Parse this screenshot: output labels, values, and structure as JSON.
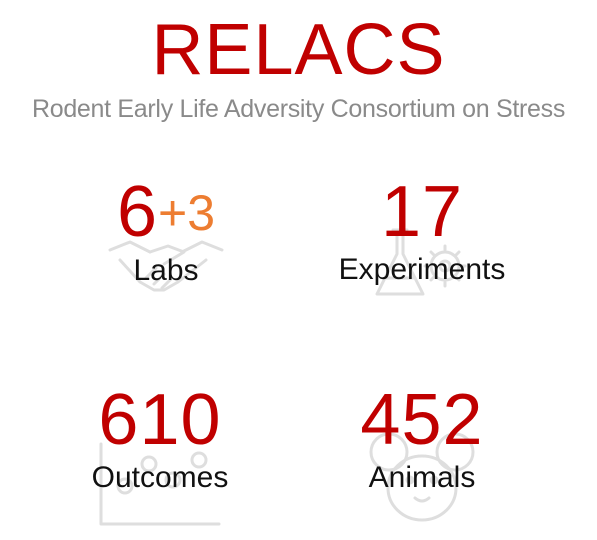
{
  "title": "RELACS",
  "subtitle": "Rodent Early Life Adversity Consortium on Stress",
  "colors": {
    "accent": "#C00000",
    "highlight": "#ED7D31",
    "subtitle": "#8a8a8a",
    "label": "#111111",
    "icon": "#d9d9d9"
  },
  "stats": {
    "labs": {
      "value": "6",
      "extra": "+3",
      "label": "Labs",
      "icon": "handshake-icon"
    },
    "experiments": {
      "value": "17",
      "label": "Experiments",
      "icon": "flask-gear-icon"
    },
    "outcomes": {
      "value": "610",
      "label": "Outcomes",
      "icon": "scatter-chart-icon"
    },
    "animals": {
      "value": "452",
      "label": "Animals",
      "icon": "mouse-face-icon"
    }
  }
}
